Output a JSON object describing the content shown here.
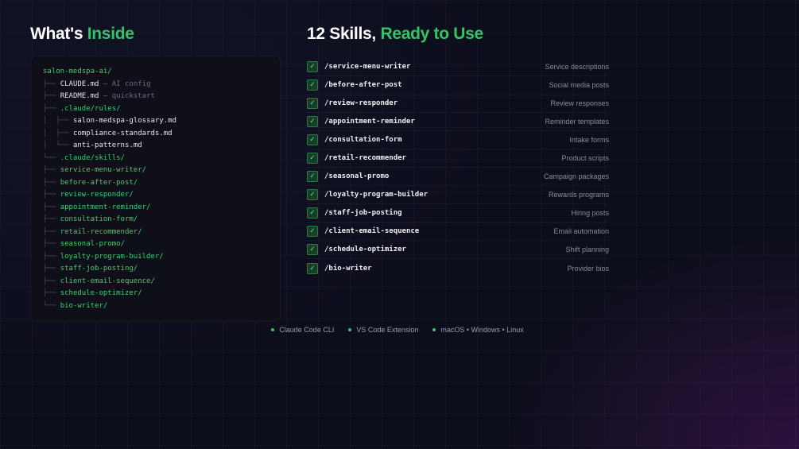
{
  "left_heading": {
    "prefix": "What's",
    "accent": "Inside"
  },
  "right_heading": {
    "prefix": "12 Skills,",
    "accent": "Ready to Use"
  },
  "tree": [
    {
      "prefix": "",
      "name": "salon-medspa-ai/",
      "type": "dir",
      "comment": ""
    },
    {
      "prefix": "├── ",
      "name": "CLAUDE.md",
      "type": "file",
      "comment": " — AI config"
    },
    {
      "prefix": "├── ",
      "name": "README.md",
      "type": "file",
      "comment": " — quickstart"
    },
    {
      "prefix": "├── ",
      "name": ".claude/rules/",
      "type": "dir",
      "comment": ""
    },
    {
      "prefix": "│  ├── ",
      "name": "salon-medspa-glossary.md",
      "type": "file",
      "comment": ""
    },
    {
      "prefix": "│  ├── ",
      "name": "compliance-standards.md",
      "type": "file",
      "comment": ""
    },
    {
      "prefix": "│  └── ",
      "name": "anti-patterns.md",
      "type": "file",
      "comment": ""
    },
    {
      "prefix": "└── ",
      "name": ".claude/skills/",
      "type": "dir",
      "comment": ""
    },
    {
      "prefix": "├── ",
      "name": "service-menu-writer/",
      "type": "dir",
      "comment": ""
    },
    {
      "prefix": "├── ",
      "name": "before-after-post/",
      "type": "dir",
      "comment": ""
    },
    {
      "prefix": "├── ",
      "name": "review-responder/",
      "type": "dir",
      "comment": ""
    },
    {
      "prefix": "├── ",
      "name": "appointment-reminder/",
      "type": "dir",
      "comment": ""
    },
    {
      "prefix": "├── ",
      "name": "consultation-form/",
      "type": "dir",
      "comment": ""
    },
    {
      "prefix": "├── ",
      "name": "retail-recommender/",
      "type": "dir",
      "comment": ""
    },
    {
      "prefix": "├── ",
      "name": "seasonal-promo/",
      "type": "dir",
      "comment": ""
    },
    {
      "prefix": "├── ",
      "name": "loyalty-program-builder/",
      "type": "dir",
      "comment": ""
    },
    {
      "prefix": "├── ",
      "name": "staff-job-posting/",
      "type": "dir",
      "comment": ""
    },
    {
      "prefix": "├── ",
      "name": "client-email-sequence/",
      "type": "dir",
      "comment": ""
    },
    {
      "prefix": "├── ",
      "name": "schedule-optimizer/",
      "type": "dir",
      "comment": ""
    },
    {
      "prefix": "└── ",
      "name": "bio-writer/",
      "type": "dir",
      "comment": ""
    }
  ],
  "skills": [
    {
      "name": "/service-menu-writer",
      "desc": "Service descriptions"
    },
    {
      "name": "/before-after-post",
      "desc": "Social media posts"
    },
    {
      "name": "/review-responder",
      "desc": "Review responses"
    },
    {
      "name": "/appointment-reminder",
      "desc": "Reminder templates"
    },
    {
      "name": "/consultation-form",
      "desc": "Intake forms"
    },
    {
      "name": "/retail-recommender",
      "desc": "Product scripts"
    },
    {
      "name": "/seasonal-promo",
      "desc": "Campaign packages"
    },
    {
      "name": "/loyalty-program-builder",
      "desc": "Rewards programs"
    },
    {
      "name": "/staff-job-posting",
      "desc": "Hiring posts"
    },
    {
      "name": "/client-email-sequence",
      "desc": "Email automation"
    },
    {
      "name": "/schedule-optimizer",
      "desc": "Shift planning"
    },
    {
      "name": "/bio-writer",
      "desc": "Provider bios"
    }
  ],
  "check_glyph": "✓",
  "footer": [
    "Claude Code CLI",
    "VS Code Extension",
    "macOS • Windows • Linux"
  ],
  "colors": {
    "accent": "#34c466",
    "background": "#0d0e1c"
  }
}
